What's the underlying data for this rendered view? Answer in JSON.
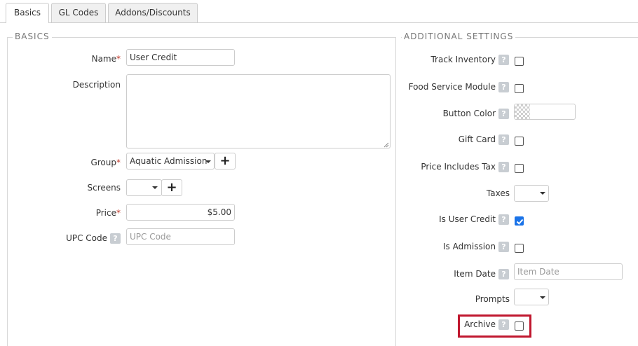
{
  "tabs": [
    "Basics",
    "GL Codes",
    "Addons/Discounts"
  ],
  "basics": {
    "legend": "BASICS",
    "name_label": "Name",
    "name_value": "User Credit",
    "description_label": "Description",
    "description_value": "",
    "group_label": "Group",
    "group_value": "Aquatic Admission",
    "screens_label": "Screens",
    "screens_value": "",
    "price_label": "Price",
    "price_value": "$5.00",
    "upc_label": "UPC Code",
    "upc_placeholder": "UPC Code",
    "required_mark": "*",
    "help_glyph": "?"
  },
  "additional": {
    "legend": "ADDITIONAL SETTINGS",
    "track_inventory_label": "Track Inventory",
    "track_inventory_checked": false,
    "food_service_label": "Food Service Module",
    "food_service_checked": false,
    "button_color_label": "Button Color",
    "gift_card_label": "Gift Card",
    "gift_card_checked": false,
    "price_includes_tax_label": "Price Includes Tax",
    "price_includes_tax_checked": false,
    "taxes_label": "Taxes",
    "taxes_value": "",
    "is_user_credit_label": "Is User Credit",
    "is_user_credit_checked": true,
    "is_admission_label": "Is Admission",
    "is_admission_checked": false,
    "item_date_label": "Item Date",
    "item_date_placeholder": "Item Date",
    "prompts_label": "Prompts",
    "prompts_value": "",
    "archive_label": "Archive",
    "archive_checked": false,
    "help_glyph": "?"
  },
  "colors": {
    "highlight": "#c0172e",
    "checkbox_checked": "#1a73e8",
    "required": "#c0392b"
  },
  "icons": {
    "add": "plus-icon",
    "dropdown": "chevron-down-icon",
    "help": "help-icon",
    "check": "checkmark-icon"
  }
}
